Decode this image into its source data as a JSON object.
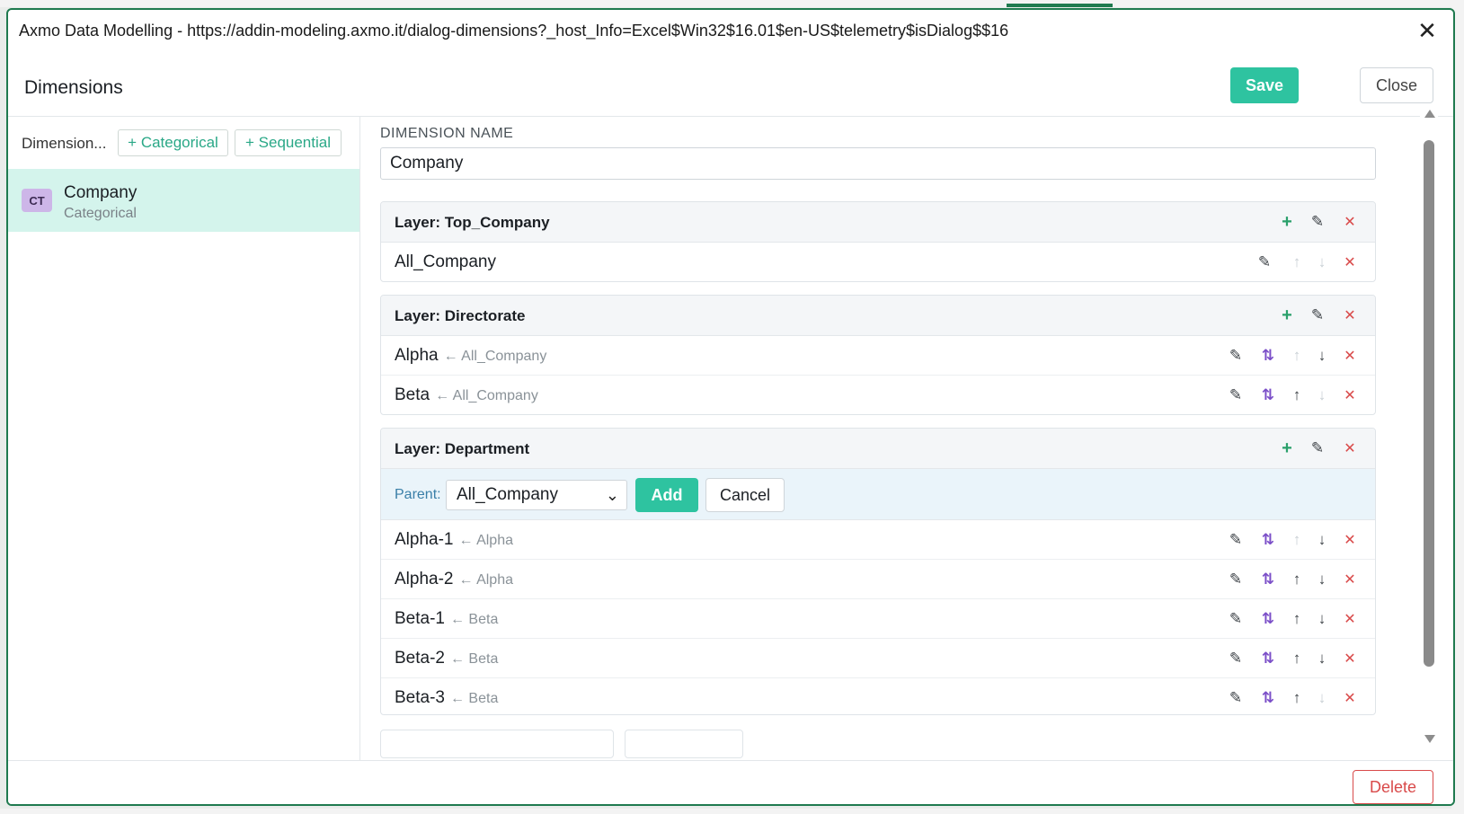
{
  "window": {
    "title": "Axmo Data Modelling - https://addin-modeling.axmo.it/dialog-dimensions?_host_Info=Excel$Win32$16.01$en-US$telemetry$isDialog$$16",
    "close_glyph": "✕"
  },
  "header": {
    "title": "Dimensions",
    "save_label": "Save",
    "close_label": "Close"
  },
  "sidebar": {
    "toolbar_label": "Dimension...",
    "add_categorical_label": "+ Categorical",
    "add_sequential_label": "+ Sequential",
    "items": [
      {
        "badge": "CT",
        "name": "Company",
        "type": "Categorical",
        "selected": true
      }
    ]
  },
  "editor": {
    "name_label": "DIMENSION NAME",
    "name_value": "Company",
    "layers": [
      {
        "title": "Layer: Top_Company",
        "rows": [
          {
            "name": "All_Company",
            "parent": ""
          }
        ]
      },
      {
        "title": "Layer: Directorate",
        "rows": [
          {
            "name": "Alpha",
            "parent": "← All_Company"
          },
          {
            "name": "Beta",
            "parent": "← All_Company"
          }
        ]
      },
      {
        "title": "Layer: Department",
        "add_form": {
          "parent_label": "Parent:",
          "parent_value": "All_Company",
          "add_label": "Add",
          "cancel_label": "Cancel"
        },
        "rows": [
          {
            "name": "Alpha-1",
            "parent": "← Alpha"
          },
          {
            "name": "Alpha-2",
            "parent": "← Alpha"
          },
          {
            "name": "Beta-1",
            "parent": "← Beta"
          },
          {
            "name": "Beta-2",
            "parent": "← Beta"
          },
          {
            "name": "Beta-3",
            "parent": "← Beta"
          }
        ]
      }
    ]
  },
  "footer": {
    "delete_label": "Delete"
  },
  "icons": {
    "add": "+",
    "edit": "✎",
    "delete": "✕",
    "swap": "⇅",
    "up": "↑",
    "down": "↓"
  },
  "colors": {
    "accent": "#2ec3a0",
    "border_frame": "#1f7a4f",
    "selected_item": "#d4f4ec",
    "danger": "#d94a4a",
    "swap": "#7b4fc8"
  }
}
